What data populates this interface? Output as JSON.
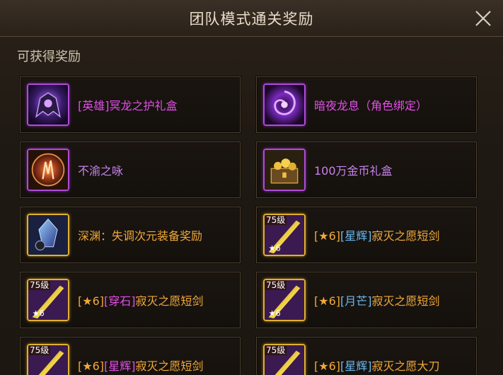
{
  "window": {
    "title": "团队模式通关奖励"
  },
  "section": {
    "subtitle": "可获得奖励"
  },
  "rewards": [
    {
      "name": "[英雄]冥龙之护礼盒",
      "color": "#e24fe8",
      "icon": "dragon-armor-box-icon"
    },
    {
      "name": "暗夜龙息（角色绑定）",
      "color": "#e24fe8",
      "icon": "dark-vortex-icon"
    },
    {
      "name": "不渝之咏",
      "color": "#c783ee",
      "icon": "flame-emblem-icon"
    },
    {
      "name": "100万金币礼盒",
      "color": "#c783ee",
      "icon": "gold-chest-icon"
    },
    {
      "name": "深渊：失调次元装备奖励",
      "color": "#f0a83a",
      "icon": "abyss-crystal-icon"
    },
    {
      "name_parts": [
        "[★6]",
        "[星辉]",
        "寂灭之愿短剑"
      ],
      "level": "75级",
      "icon": "short-sword-icon"
    },
    {
      "name_parts": [
        "[★6]",
        "[穿石]",
        "寂灭之愿短剑"
      ],
      "level": "75级",
      "icon": "short-sword-icon"
    },
    {
      "name_parts": [
        "[★6]",
        "[月芒]",
        "寂灭之愿短剑"
      ],
      "level": "75级",
      "icon": "short-sword-icon"
    },
    {
      "name_parts": [
        "[★6]",
        "[星辉]",
        "寂灭之愿短剑"
      ],
      "level": "75级",
      "icon": "short-sword-icon"
    },
    {
      "name_parts": [
        "[★6]",
        "[星辉]",
        "寂灭之愿大刀"
      ],
      "level": "75级",
      "icon": "great-sword-icon"
    }
  ],
  "colors": {
    "epic": "#e24fe8",
    "rare": "#c783ee",
    "legend": "#f0a83a",
    "tag": "#6ab8f0",
    "tag_pink": "#e24fe8"
  }
}
